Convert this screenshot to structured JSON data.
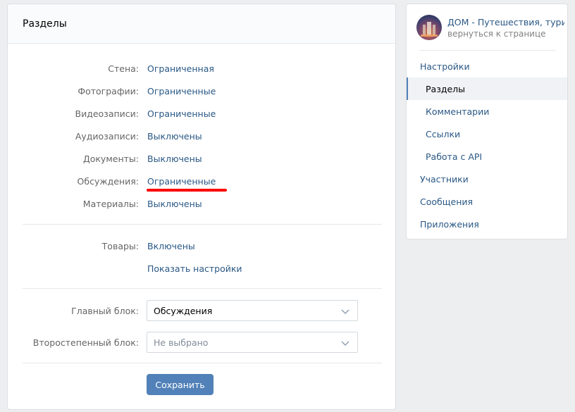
{
  "main": {
    "title": "Разделы",
    "sections": [
      {
        "label": "Стена:",
        "value": "Ограниченная"
      },
      {
        "label": "Фотографии:",
        "value": "Ограниченные"
      },
      {
        "label": "Видеозаписи:",
        "value": "Ограниченные"
      },
      {
        "label": "Аудиозаписи:",
        "value": "Выключены"
      },
      {
        "label": "Документы:",
        "value": "Выключены"
      },
      {
        "label": "Обсуждения:",
        "value": "Ограниченные"
      },
      {
        "label": "Материалы:",
        "value": "Выключены"
      }
    ],
    "goods": {
      "label": "Товары:",
      "value": "Включены",
      "settings_link": "Показать настройки"
    },
    "main_block": {
      "label": "Главный блок:",
      "value": "Обсуждения"
    },
    "secondary_block": {
      "label": "Второстепенный блок:",
      "value": "Не выбрано"
    },
    "save_label": "Сохранить",
    "colors": {
      "link": "#2a5885",
      "button": "#5181b8",
      "highlight": "#ff0000"
    }
  },
  "sidebar": {
    "group_name": "ДОМ - Путешествия, тури...",
    "back_link": "вернуться к странице",
    "items": [
      {
        "label": "Настройки",
        "level": "top",
        "active": false
      },
      {
        "label": "Разделы",
        "level": "sub",
        "active": true
      },
      {
        "label": "Комментарии",
        "level": "sub",
        "active": false
      },
      {
        "label": "Ссылки",
        "level": "sub",
        "active": false
      },
      {
        "label": "Работа с API",
        "level": "sub",
        "active": false
      },
      {
        "label": "Участники",
        "level": "top",
        "active": false
      },
      {
        "label": "Сообщения",
        "level": "top",
        "active": false
      },
      {
        "label": "Приложения",
        "level": "top",
        "active": false
      }
    ]
  }
}
